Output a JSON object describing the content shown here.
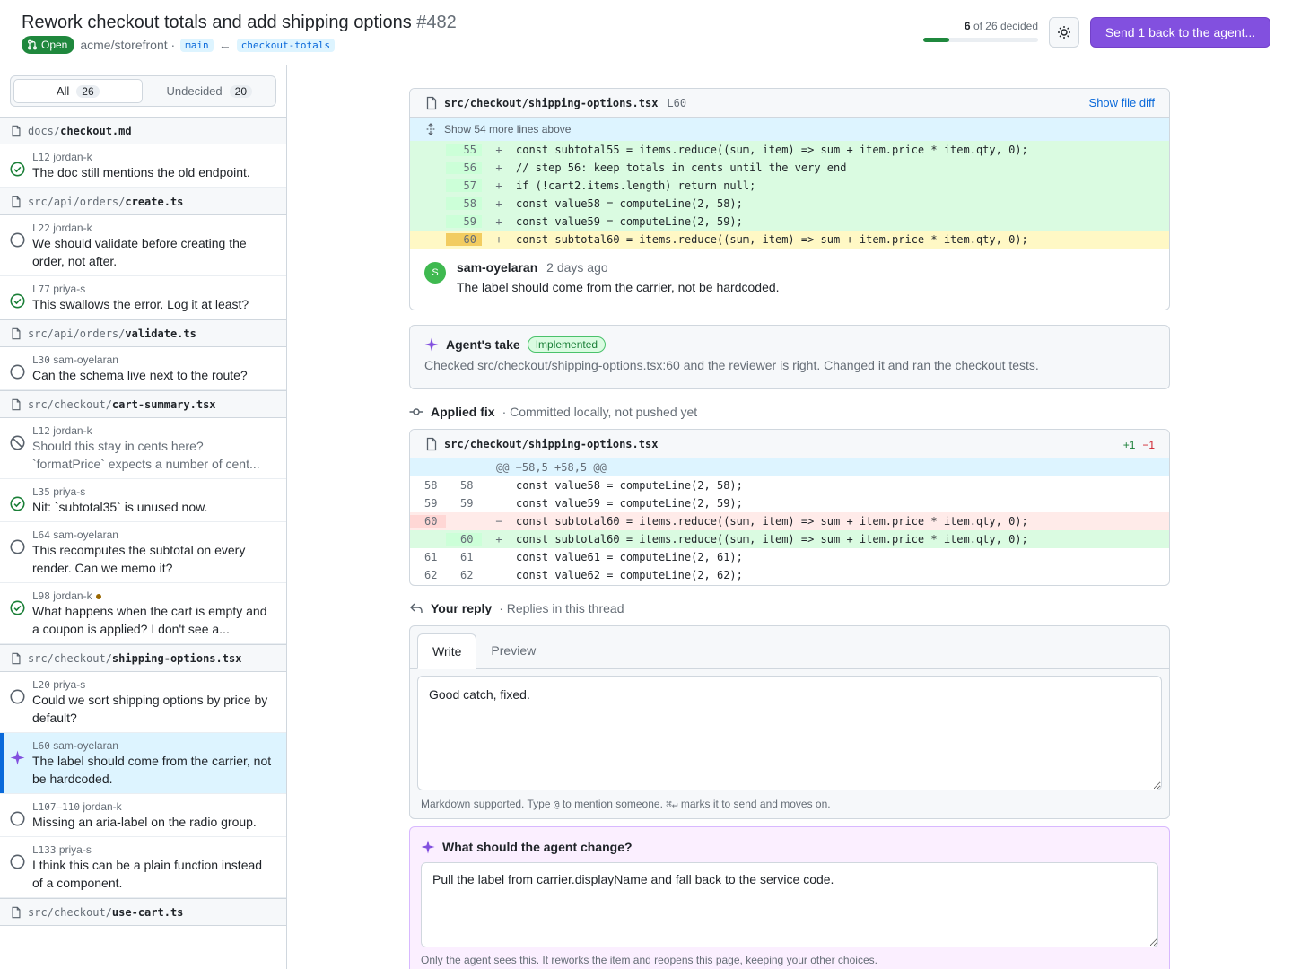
{
  "header": {
    "title": "Rework checkout totals and add shipping options",
    "number": "#482",
    "state": "Open",
    "repo": "acme/storefront ·",
    "base_branch": "main",
    "arrow": "←",
    "head_branch": "checkout-totals",
    "decided_count": "6",
    "decided_suffix": "of 26 decided",
    "progress_fraction": 0.23,
    "send_button": "Send 1 back to the agent..."
  },
  "sidebar": {
    "filters": [
      {
        "label": "All",
        "count": "26"
      },
      {
        "label": "Undecided",
        "count": "20"
      }
    ],
    "files": [
      {
        "dir": "docs/",
        "name": "checkout.md",
        "items": [
          {
            "status": "done",
            "line": "L12",
            "author": "jordan-k",
            "text": "The doc still mentions the old endpoint."
          }
        ]
      },
      {
        "dir": "src/api/orders/",
        "name": "create.ts",
        "items": [
          {
            "status": "open",
            "line": "L22",
            "author": "jordan-k",
            "text": "We should validate before creating the order, not after."
          },
          {
            "status": "done",
            "line": "L77",
            "author": "priya-s",
            "text": "This swallows the error. Log it at least?"
          }
        ]
      },
      {
        "dir": "src/api/orders/",
        "name": "validate.ts",
        "items": [
          {
            "status": "open",
            "line": "L30",
            "author": "sam-oyelaran",
            "text": "Can the schema live next to the route?"
          }
        ]
      },
      {
        "dir": "src/checkout/",
        "name": "cart-summary.tsx",
        "items": [
          {
            "status": "skip",
            "line": "L12",
            "author": "jordan-k",
            "text": "Should this stay in cents here? `formatPrice` expects a number of cent..."
          },
          {
            "status": "done",
            "line": "L35",
            "author": "priya-s",
            "text": "Nit: `subtotal35` is unused now."
          },
          {
            "status": "open",
            "line": "L64",
            "author": "sam-oyelaran",
            "text": "This recomputes the subtotal on every render. Can we memo it?"
          },
          {
            "status": "done",
            "line": "L98",
            "author": "jordan-k",
            "text": "What happens when the cart is empty and a coupon is applied? I don't see a..."
          }
        ]
      },
      {
        "dir": "src/checkout/",
        "name": "shipping-options.tsx",
        "items": [
          {
            "status": "open",
            "line": "L20",
            "author": "priya-s",
            "text": "Could we sort shipping options by price by default?"
          },
          {
            "status": "agent",
            "line": "L60",
            "author": "sam-oyelaran",
            "text": "The label should come from the carrier, not be hardcoded."
          },
          {
            "status": "open",
            "line": "L107–110",
            "author": "jordan-k",
            "text": "Missing an aria-label on the radio group."
          },
          {
            "status": "open",
            "line": "L133",
            "author": "priya-s",
            "text": "I think this can be a plain function instead of a component."
          }
        ]
      },
      {
        "dir": "src/checkout/",
        "name": "use-cart.ts",
        "items": []
      }
    ]
  },
  "context_panel": {
    "file": "src/checkout/shipping-options.tsx",
    "line_ref": "L60",
    "show_diff": "Show file diff",
    "expand_label": "Show 54 more lines above",
    "lines": [
      {
        "n": "55",
        "sign": "+",
        "code": "const subtotal55 = items.reduce((sum, item) => sum + item.price * item.qty, 0);"
      },
      {
        "n": "56",
        "sign": "+",
        "code": "// step 56: keep totals in cents until the very end"
      },
      {
        "n": "57",
        "sign": "+",
        "code": "if (!cart2.items.length) return null;"
      },
      {
        "n": "58",
        "sign": "+",
        "code": "const value58 = computeLine(2, 58);"
      },
      {
        "n": "59",
        "sign": "+",
        "code": "const value59 = computeLine(2, 59);"
      },
      {
        "n": "60",
        "sign": "+",
        "code": "const subtotal60 = items.reduce((sum, item) => sum + item.price * item.qty, 0);"
      }
    ],
    "comment": {
      "avatar": "S",
      "author": "sam-oyelaran",
      "time": "2 days ago",
      "body": "The label should come from the carrier, not be hardcoded."
    }
  },
  "agent_take": {
    "title": "Agent's take",
    "badge": "Implemented",
    "text": "Checked src/checkout/shipping-options.tsx:60 and the reviewer is right. Changed it and ran the checkout tests."
  },
  "applied_fix": {
    "label": "Applied fix",
    "note": "· Committed locally, not pushed yet",
    "file": "src/checkout/shipping-options.tsx",
    "added": "+1",
    "removed": "−1",
    "hunk": "@@ −58,5 +58,5 @@",
    "lines": [
      {
        "type": "ctx",
        "old": "58",
        "new": "58",
        "sign": "",
        "code": "const value58 = computeLine(2, 58);"
      },
      {
        "type": "ctx",
        "old": "59",
        "new": "59",
        "sign": "",
        "code": "const value59 = computeLine(2, 59);"
      },
      {
        "type": "del",
        "old": "60",
        "new": "",
        "sign": "−",
        "code": "const subtotal60 = items.reduce((sum, item) => sum + item.price * item.qty, 0);"
      },
      {
        "type": "add",
        "old": "",
        "new": "60",
        "sign": "+",
        "code": "const subtotal60 = items.reduce((sum, item) => sum + item.price * item.qty, 0);"
      },
      {
        "type": "ctx",
        "old": "61",
        "new": "61",
        "sign": "",
        "code": "const value61 = computeLine(2, 61);"
      },
      {
        "type": "ctx",
        "old": "62",
        "new": "62",
        "sign": "",
        "code": "const value62 = computeLine(2, 62);"
      }
    ]
  },
  "reply": {
    "label": "Your reply",
    "note": "· Replies in this thread",
    "tab_write": "Write",
    "tab_preview": "Preview",
    "value": "Good catch, fixed.",
    "hint_prefix": "Markdown supported. Type",
    "hint_at": "@",
    "hint_middle": "to mention someone.",
    "hint_kbd": "⌘↵",
    "hint_suffix": "marks it to send and moves on."
  },
  "agent_change": {
    "title": "What should the agent change?",
    "value": "Pull the label from carrier.displayName and fall back to the service code.",
    "hint": "Only the agent sees this. It reworks the item and reopens this page, keeping your other choices."
  },
  "colors": {
    "accent": "#8250df",
    "open_green": "#1f883d",
    "link_blue": "#0969da"
  }
}
